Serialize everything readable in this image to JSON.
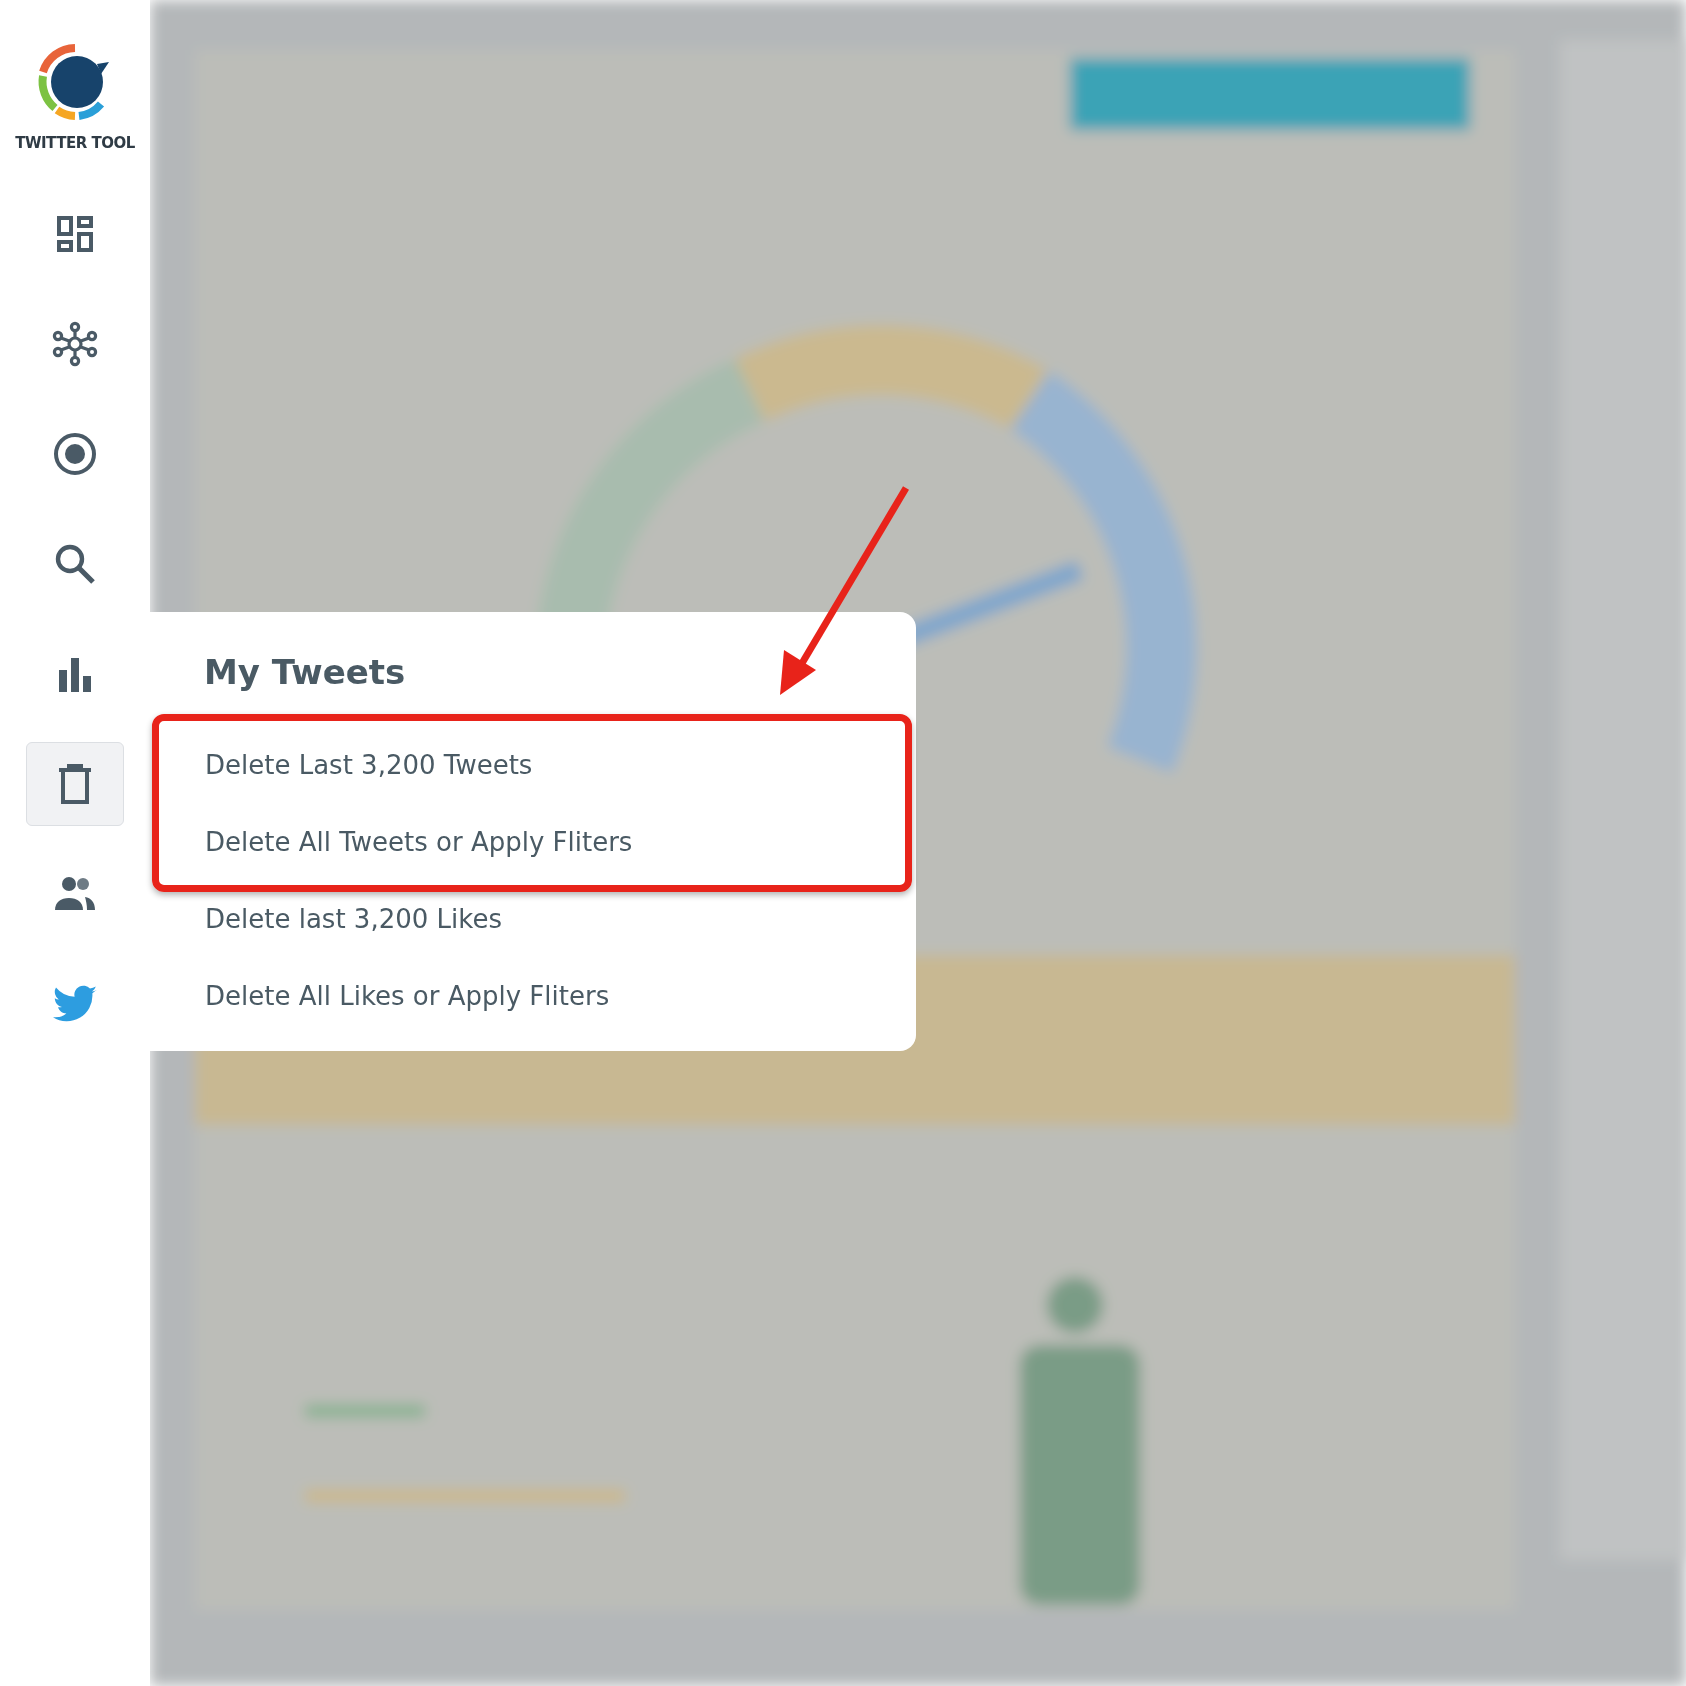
{
  "sidebar": {
    "brand": "TWITTER TOOL",
    "items": [
      {
        "kind": "dashboard",
        "selected": false
      },
      {
        "kind": "network",
        "selected": false
      },
      {
        "kind": "target",
        "selected": false
      },
      {
        "kind": "search",
        "selected": false
      },
      {
        "kind": "chart",
        "selected": false
      },
      {
        "kind": "trash",
        "selected": true
      },
      {
        "kind": "people",
        "selected": false
      },
      {
        "kind": "bird",
        "selected": false
      }
    ]
  },
  "menu": {
    "title": "My Tweets",
    "items": [
      {
        "label": "Delete Last 3,200 Tweets",
        "highlighted": true
      },
      {
        "label": "Delete All Tweets or Apply Fliters",
        "highlighted": true
      },
      {
        "label": "Delete last 3,200 Likes",
        "highlighted": false
      },
      {
        "label": "Delete All Likes or Apply Fliters",
        "highlighted": false
      }
    ]
  }
}
